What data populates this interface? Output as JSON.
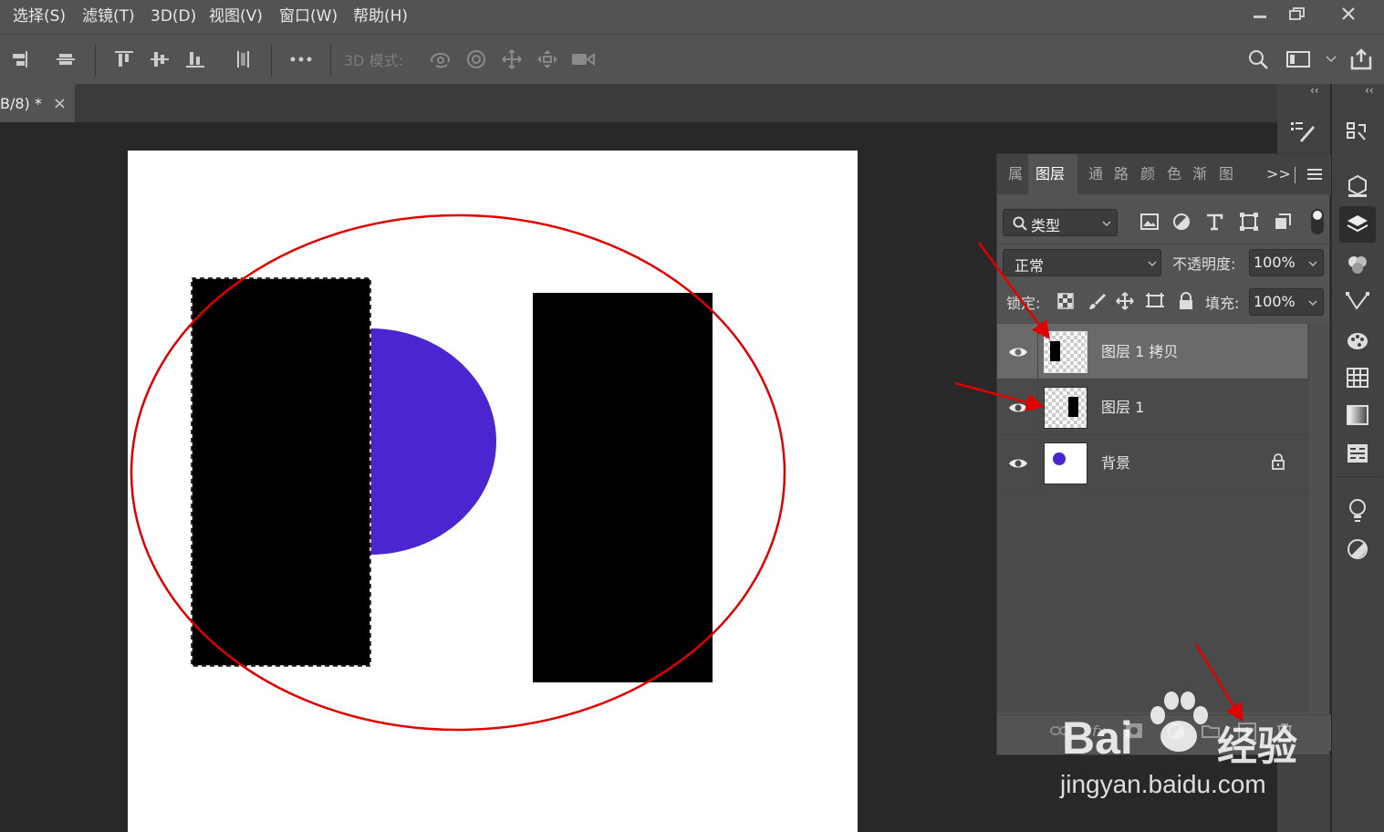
{
  "menu": {
    "items": [
      "选择(S)",
      "滤镜(T)",
      "3D(D)",
      "视图(V)",
      "窗口(W)",
      "帮助(H)"
    ]
  },
  "options_bar": {
    "mode_3d_label": "3D 模式:"
  },
  "document_tab": {
    "title": "B/8) *",
    "close": "×"
  },
  "panel_tabs": [
    "属",
    "图层",
    "通",
    "路",
    "颜",
    "色",
    "渐",
    "图"
  ],
  "panel_more": ">>",
  "layers_panel": {
    "filter_label": "类型",
    "blend_mode": "正常",
    "opacity_label": "不透明度:",
    "opacity_value": "100%",
    "lock_label": "锁定:",
    "fill_label": "填充:",
    "fill_value": "100%",
    "layers": [
      {
        "name": "图层 1 拷贝",
        "selected": true
      },
      {
        "name": "图层 1",
        "selected": false
      },
      {
        "name": "背景",
        "selected": false,
        "locked": true
      }
    ]
  },
  "watermark": {
    "brand": "Bai",
    "brand2": "经验",
    "url": "jingyan.baidu.com"
  },
  "colors": {
    "annotation_red": "#e00000",
    "semicircle": "#4b25cf",
    "ui_panel": "#535353",
    "ui_dark": "#282828"
  }
}
